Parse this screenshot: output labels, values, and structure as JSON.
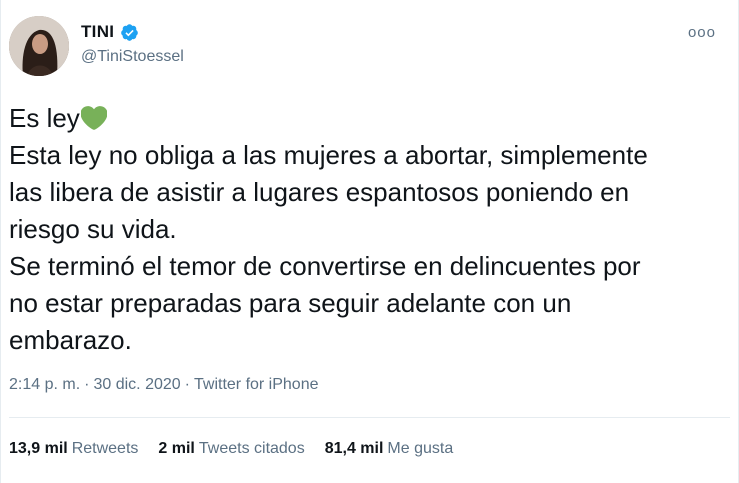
{
  "author": {
    "name": "TINI",
    "handle": "@TiniStoessel",
    "verified_icon": "verified-badge-icon",
    "avatar_icon": "profile-photo"
  },
  "more_icon": "more-options-icon",
  "more_label": "ooo",
  "tweet": {
    "lines": [
      "Es ley",
      "Esta ley no obliga a las mujeres a abortar, simplemente",
      "las libera de asistir a lugares espantosos poniendo en",
      "riesgo su vida.",
      "Se terminó el temor de convertirse en delincuentes por",
      "no estar preparadas para seguir adelante con un",
      "embarazo."
    ],
    "emoji": "green-heart-icon"
  },
  "meta": {
    "time": "2:14 p. m.",
    "separator": "·",
    "date": "30 dic. 2020",
    "source": "Twitter for iPhone"
  },
  "stats": {
    "retweets_count": "13,9 mil",
    "retweets_label": "Retweets",
    "quotes_count": "2 mil",
    "quotes_label": "Tweets citados",
    "likes_count": "81,4 mil",
    "likes_label": "Me gusta"
  },
  "colors": {
    "verified": "#1da1f2",
    "heart": "#78b159",
    "secondary_text": "#5b7083",
    "divider": "#e6ecf0"
  }
}
